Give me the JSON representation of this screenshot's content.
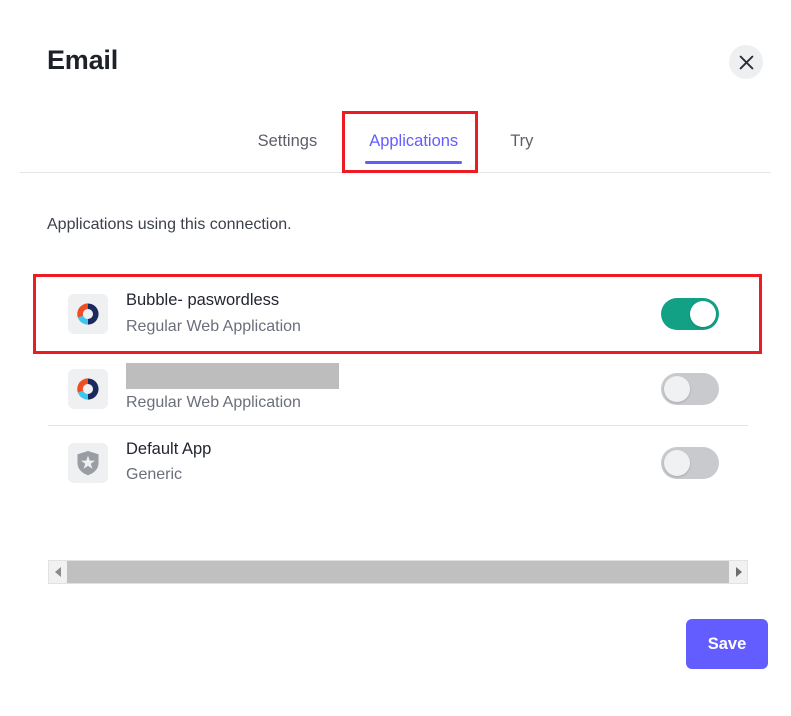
{
  "modal": {
    "title": "Email",
    "close_icon": "close-icon"
  },
  "tabs": [
    {
      "label": "Settings",
      "active": false
    },
    {
      "label": "Applications",
      "active": true
    },
    {
      "label": "Try",
      "active": false
    }
  ],
  "main": {
    "description": "Applications using this connection.",
    "applications": [
      {
        "name": "Bubble- paswordless",
        "type": "Regular Web Application",
        "icon": "app-logo-icon",
        "enabled": true,
        "redacted": false
      },
      {
        "name": "",
        "type": "Regular Web Application",
        "icon": "app-logo-icon",
        "enabled": false,
        "redacted": true
      },
      {
        "name": "Default App",
        "type": "Generic",
        "icon": "auth0-shield-icon",
        "enabled": false,
        "redacted": false
      }
    ]
  },
  "scrollbar": {
    "left_arrow_icon": "chevron-left-icon",
    "right_arrow_icon": "chevron-right-icon"
  },
  "footer": {
    "save_label": "Save"
  },
  "colors": {
    "accent": "#635dff",
    "toggle_on": "#13a186",
    "toggle_off": "#c8cace",
    "annotation": "#ed1c24",
    "redaction": "#bdbdbd"
  }
}
